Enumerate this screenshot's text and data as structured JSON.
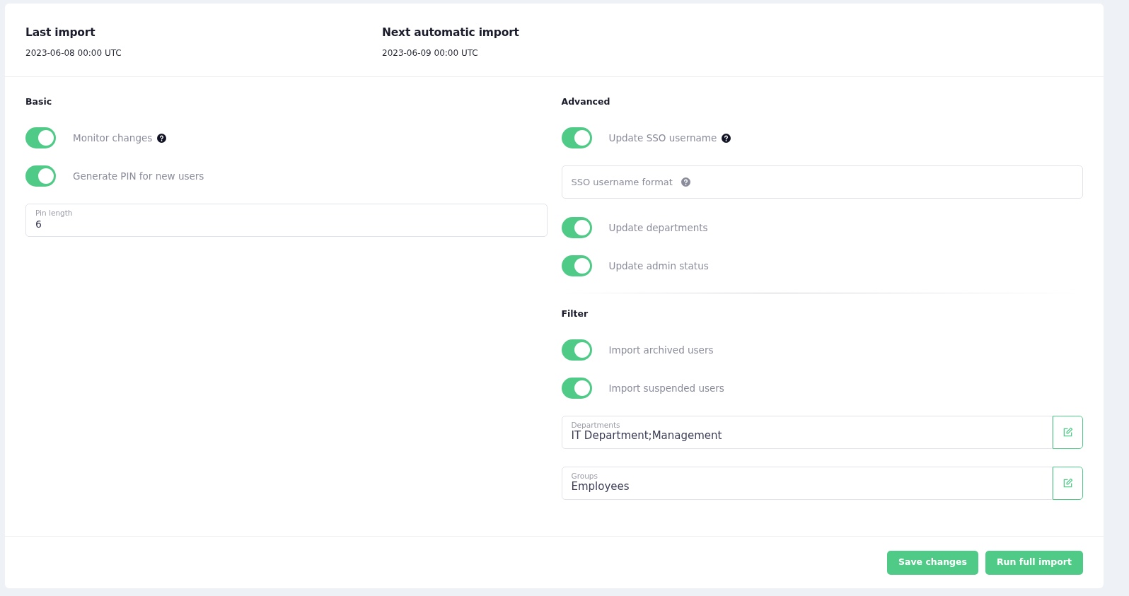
{
  "header": [
    {
      "label": "Last import",
      "value": "2023-06-08 00:00 UTC"
    },
    {
      "label": "Next automatic import",
      "value": "2023-06-09 00:00 UTC"
    }
  ],
  "columns": [
    {
      "sections": [
        {
          "title": "Basic",
          "items": [
            {
              "kind": "toggle",
              "label": "Monitor changes",
              "on": true,
              "help": true
            },
            {
              "kind": "toggle",
              "label": "Generate PIN for new users",
              "on": true,
              "help": false
            },
            {
              "kind": "field",
              "label": "Pin length",
              "value": "6"
            }
          ]
        }
      ]
    },
    {
      "sections": [
        {
          "title": "Advanced",
          "items": [
            {
              "kind": "toggle",
              "label": "Update SSO username",
              "on": true,
              "help": true
            },
            {
              "kind": "input",
              "placeholder": "SSO username format",
              "help": true
            },
            {
              "kind": "toggle",
              "label": "Update departments",
              "on": true,
              "help": false
            },
            {
              "kind": "toggle",
              "label": "Update admin status",
              "on": true,
              "help": false
            }
          ]
        },
        {
          "title": "Filter",
          "items": [
            {
              "kind": "toggle",
              "label": "Import archived users",
              "on": true,
              "help": false
            },
            {
              "kind": "toggle",
              "label": "Import suspended users",
              "on": true,
              "help": false
            },
            {
              "kind": "edit-field",
              "label": "Departments",
              "value": "IT Department;Management"
            },
            {
              "kind": "edit-field",
              "label": "Groups",
              "value": "Employees"
            }
          ]
        }
      ]
    }
  ],
  "buttons": [
    "Save changes",
    "Run full import"
  ]
}
